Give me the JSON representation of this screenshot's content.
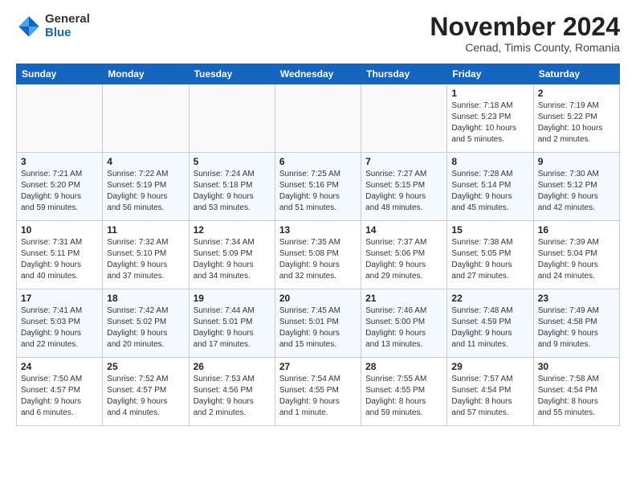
{
  "logo": {
    "general": "General",
    "blue": "Blue"
  },
  "header": {
    "month": "November 2024",
    "location": "Cenad, Timis County, Romania"
  },
  "weekdays": [
    "Sunday",
    "Monday",
    "Tuesday",
    "Wednesday",
    "Thursday",
    "Friday",
    "Saturday"
  ],
  "weeks": [
    [
      {
        "day": "",
        "info": ""
      },
      {
        "day": "",
        "info": ""
      },
      {
        "day": "",
        "info": ""
      },
      {
        "day": "",
        "info": ""
      },
      {
        "day": "",
        "info": ""
      },
      {
        "day": "1",
        "info": "Sunrise: 7:18 AM\nSunset: 5:23 PM\nDaylight: 10 hours\nand 5 minutes."
      },
      {
        "day": "2",
        "info": "Sunrise: 7:19 AM\nSunset: 5:22 PM\nDaylight: 10 hours\nand 2 minutes."
      }
    ],
    [
      {
        "day": "3",
        "info": "Sunrise: 7:21 AM\nSunset: 5:20 PM\nDaylight: 9 hours\nand 59 minutes."
      },
      {
        "day": "4",
        "info": "Sunrise: 7:22 AM\nSunset: 5:19 PM\nDaylight: 9 hours\nand 56 minutes."
      },
      {
        "day": "5",
        "info": "Sunrise: 7:24 AM\nSunset: 5:18 PM\nDaylight: 9 hours\nand 53 minutes."
      },
      {
        "day": "6",
        "info": "Sunrise: 7:25 AM\nSunset: 5:16 PM\nDaylight: 9 hours\nand 51 minutes."
      },
      {
        "day": "7",
        "info": "Sunrise: 7:27 AM\nSunset: 5:15 PM\nDaylight: 9 hours\nand 48 minutes."
      },
      {
        "day": "8",
        "info": "Sunrise: 7:28 AM\nSunset: 5:14 PM\nDaylight: 9 hours\nand 45 minutes."
      },
      {
        "day": "9",
        "info": "Sunrise: 7:30 AM\nSunset: 5:12 PM\nDaylight: 9 hours\nand 42 minutes."
      }
    ],
    [
      {
        "day": "10",
        "info": "Sunrise: 7:31 AM\nSunset: 5:11 PM\nDaylight: 9 hours\nand 40 minutes."
      },
      {
        "day": "11",
        "info": "Sunrise: 7:32 AM\nSunset: 5:10 PM\nDaylight: 9 hours\nand 37 minutes."
      },
      {
        "day": "12",
        "info": "Sunrise: 7:34 AM\nSunset: 5:09 PM\nDaylight: 9 hours\nand 34 minutes."
      },
      {
        "day": "13",
        "info": "Sunrise: 7:35 AM\nSunset: 5:08 PM\nDaylight: 9 hours\nand 32 minutes."
      },
      {
        "day": "14",
        "info": "Sunrise: 7:37 AM\nSunset: 5:06 PM\nDaylight: 9 hours\nand 29 minutes."
      },
      {
        "day": "15",
        "info": "Sunrise: 7:38 AM\nSunset: 5:05 PM\nDaylight: 9 hours\nand 27 minutes."
      },
      {
        "day": "16",
        "info": "Sunrise: 7:39 AM\nSunset: 5:04 PM\nDaylight: 9 hours\nand 24 minutes."
      }
    ],
    [
      {
        "day": "17",
        "info": "Sunrise: 7:41 AM\nSunset: 5:03 PM\nDaylight: 9 hours\nand 22 minutes."
      },
      {
        "day": "18",
        "info": "Sunrise: 7:42 AM\nSunset: 5:02 PM\nDaylight: 9 hours\nand 20 minutes."
      },
      {
        "day": "19",
        "info": "Sunrise: 7:44 AM\nSunset: 5:01 PM\nDaylight: 9 hours\nand 17 minutes."
      },
      {
        "day": "20",
        "info": "Sunrise: 7:45 AM\nSunset: 5:01 PM\nDaylight: 9 hours\nand 15 minutes."
      },
      {
        "day": "21",
        "info": "Sunrise: 7:46 AM\nSunset: 5:00 PM\nDaylight: 9 hours\nand 13 minutes."
      },
      {
        "day": "22",
        "info": "Sunrise: 7:48 AM\nSunset: 4:59 PM\nDaylight: 9 hours\nand 11 minutes."
      },
      {
        "day": "23",
        "info": "Sunrise: 7:49 AM\nSunset: 4:58 PM\nDaylight: 9 hours\nand 9 minutes."
      }
    ],
    [
      {
        "day": "24",
        "info": "Sunrise: 7:50 AM\nSunset: 4:57 PM\nDaylight: 9 hours\nand 6 minutes."
      },
      {
        "day": "25",
        "info": "Sunrise: 7:52 AM\nSunset: 4:57 PM\nDaylight: 9 hours\nand 4 minutes."
      },
      {
        "day": "26",
        "info": "Sunrise: 7:53 AM\nSunset: 4:56 PM\nDaylight: 9 hours\nand 2 minutes."
      },
      {
        "day": "27",
        "info": "Sunrise: 7:54 AM\nSunset: 4:55 PM\nDaylight: 9 hours\nand 1 minute."
      },
      {
        "day": "28",
        "info": "Sunrise: 7:55 AM\nSunset: 4:55 PM\nDaylight: 8 hours\nand 59 minutes."
      },
      {
        "day": "29",
        "info": "Sunrise: 7:57 AM\nSunset: 4:54 PM\nDaylight: 8 hours\nand 57 minutes."
      },
      {
        "day": "30",
        "info": "Sunrise: 7:58 AM\nSunset: 4:54 PM\nDaylight: 8 hours\nand 55 minutes."
      }
    ]
  ]
}
